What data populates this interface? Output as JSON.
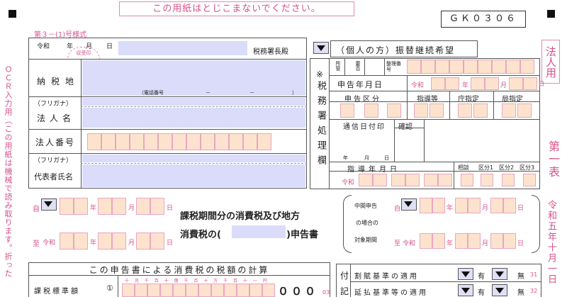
{
  "notice": "この用紙はとじこまないでください。",
  "form_code": "ＧＫ０３０６",
  "form_style": "第３－(1)号様式",
  "era": "令和",
  "year": "年",
  "month": "月",
  "day": "日",
  "tax_office": "税務署長殿",
  "received_stamp": "収受印",
  "transfer_label": "（個人の方）振替継続希望",
  "taxpayer": {
    "address_label": "納税地",
    "phone_label": "（電話番号",
    "phone_sep1": "－",
    "phone_sep2": "－",
    "phone_close": "）",
    "kana_label": "（フリガナ）",
    "corp_name_label": "法人名",
    "corp_number_label": "法人番号",
    "kana_label2": "（フリガナ）",
    "rep_label": "代表者氏名"
  },
  "office_use": {
    "marker": "※",
    "vertical_label": "税務署処理欄",
    "h1": "所管",
    "h2": "要否",
    "h3": "整理番号",
    "filing_date": "申告年月日",
    "filing_class": "申告区分",
    "guidance": "指導等",
    "office_designation": "庁指定",
    "bureau_designation": "局指定",
    "comm_date": "通信日付印",
    "confirm": "確認",
    "year_small": "年",
    "month_small": "月",
    "day_small": "日",
    "guidance_date": "指導年月日",
    "consult": "相談",
    "cat1": "区分1",
    "cat2": "区分2",
    "cat3": "区分3"
  },
  "side_label_left": "ＯＣＲ入力用（この用紙は機械で読み取ります。折った",
  "side_label_right_top": "法人用",
  "side_label_right_mid": "第一表",
  "side_label_right_bottom": "令和五年十月一日",
  "period": {
    "from_label": "自",
    "to_label": "至",
    "era": "令和",
    "title_line1": "課税期間分の消費税及び地方",
    "title_line2_a": "消費税の(",
    "title_line2_b": ")申告書",
    "interim_line1": "中間申告",
    "interim_line2": "の場合の",
    "interim_line3": "対象期間",
    "interim_from": "自",
    "interim_to": "至"
  },
  "calc_section": {
    "title": "この申告書による消費税の税額の計算",
    "row1_label": "課税標準額",
    "row1_num": "①",
    "digits_header": "十 兆 千 百 十 億 千 百 十 万 千 百 十 一 円",
    "row1_value": "０００",
    "row1_code": "03"
  },
  "notes_section": {
    "label1": "付",
    "label2": "記",
    "row1": "割賦基準の適用",
    "row2": "延払基準等の適用",
    "yes": "有",
    "no": "無",
    "row1_code": "31",
    "row2_code": "32"
  }
}
